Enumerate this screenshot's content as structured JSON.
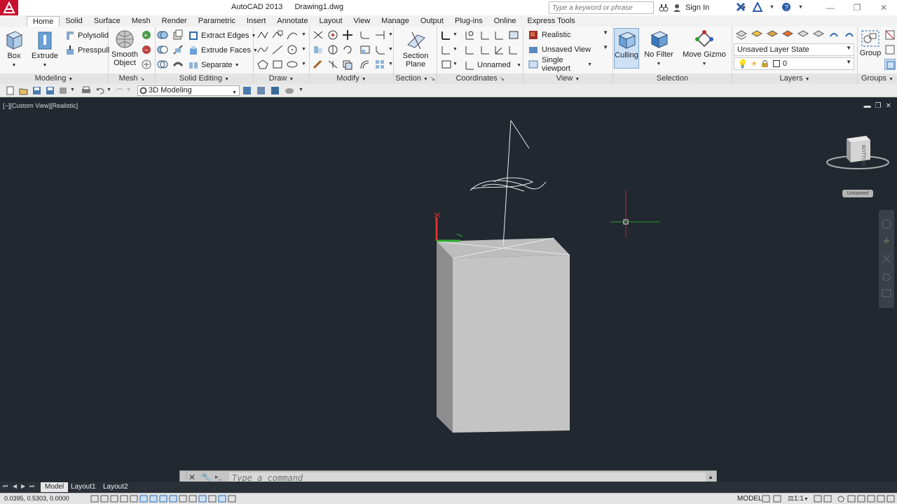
{
  "title": {
    "app": "AutoCAD 2013",
    "file": "Drawing1.dwg",
    "search_placeholder": "Type a keyword or phrase",
    "signin": "Sign In"
  },
  "ribbon_tabs": [
    "Home",
    "Solid",
    "Surface",
    "Mesh",
    "Render",
    "Parametric",
    "Insert",
    "Annotate",
    "Layout",
    "View",
    "Manage",
    "Output",
    "Plug-ins",
    "Online",
    "Express Tools"
  ],
  "ribbon": {
    "modeling": {
      "title": "Modeling",
      "box": "Box",
      "extrude": "Extrude",
      "polysolid": "Polysolid",
      "presspull": "Presspull"
    },
    "mesh": {
      "title": "Mesh",
      "smooth_object_1": "Smooth",
      "smooth_object_2": "Object"
    },
    "solid_editing": {
      "title": "Solid Editing",
      "extract_edges": "Extract Edges",
      "extrude_faces": "Extrude Faces",
      "separate": "Separate"
    },
    "draw": {
      "title": "Draw"
    },
    "modify": {
      "title": "Modify"
    },
    "section": {
      "title": "Section",
      "section_plane_1": "Section",
      "section_plane_2": "Plane"
    },
    "coordinates": {
      "title": "Coordinates",
      "ucs_name": "Unnamed"
    },
    "view": {
      "title": "View",
      "visual_style": "Realistic",
      "named_view": "Unsaved View",
      "viewport": "Single viewport"
    },
    "selection": {
      "title": "Selection",
      "culling": "Culling",
      "no_filter": "No Filter",
      "move_gizmo": "Move Gizmo"
    },
    "layers": {
      "title": "Layers",
      "layer_state": "Unsaved Layer State",
      "current_layer": "0"
    },
    "groups": {
      "title": "Groups",
      "group": "Group"
    }
  },
  "qat": {
    "workspace": "3D Modeling"
  },
  "viewport": {
    "label": "[−][Custom View][Realistic]",
    "viewcube_face": "BOTTOM",
    "ucs_menu": "Unnamed"
  },
  "command": {
    "placeholder": "Type a command"
  },
  "layout_tabs": [
    "Model",
    "Layout1",
    "Layout2"
  ],
  "status": {
    "coords": "0.0395, 0.5303, 0.0000",
    "model": "MODEL",
    "scale": "1:1"
  },
  "colors": {
    "viewport_bg": "#212830",
    "app_red": "#c8102e",
    "ucs_x": "#e03030",
    "ucs_y": "#30b030"
  }
}
